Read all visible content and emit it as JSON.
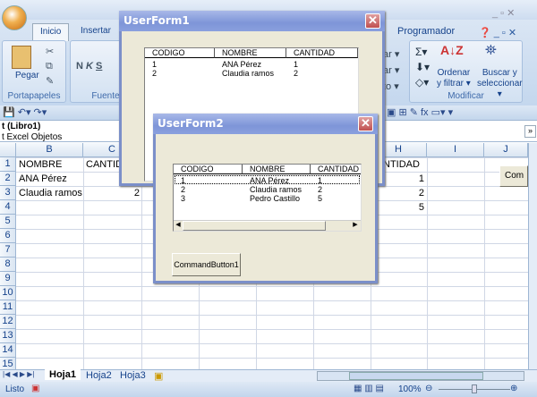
{
  "ribbon": {
    "tabs": [
      "Inicio",
      "Insertar",
      "Programador"
    ],
    "clipboard": {
      "paste": "Pegar",
      "group": "Portapapeles"
    },
    "font_group": "Fuente",
    "edit": {
      "sort": "Ordenar",
      "sort2": "y filtrar ▾",
      "find": "Buscar y",
      "find2": "seleccionar ▾",
      "group": "Modificar"
    },
    "partial": [
      "ar ▾",
      "ar ▾",
      "to ▾"
    ]
  },
  "formula_bar": {
    "line1": "t (Libro1)",
    "line2": "t Excel Objetos"
  },
  "columns": [
    "B",
    "C",
    "H",
    "I",
    "J"
  ],
  "rows": [
    "1",
    "2",
    "3",
    "4",
    "5",
    "6",
    "7",
    "8",
    "9",
    "10",
    "11",
    "12",
    "13",
    "14",
    "15"
  ],
  "cells": {
    "b1": "NOMBRE",
    "c1": "CANTID",
    "b2": "ANA Pérez",
    "b3": "Claudia ramos",
    "c3": "2",
    "h1": "NTIDAD",
    "h2": "1",
    "h3": "2",
    "h4": "5",
    "j2_button": "Com"
  },
  "sheet_tabs": [
    "Hoja1",
    "Hoja2",
    "Hoja3"
  ],
  "status": {
    "ready": "Listo",
    "zoom": "100%"
  },
  "userform1": {
    "title": "UserForm1",
    "headers": [
      "CODIGO",
      "NOMBRE",
      "CANTIDAD"
    ],
    "rows": [
      [
        "1",
        "ANA Pérez",
        "1"
      ],
      [
        "2",
        "Claudia ramos",
        "2"
      ]
    ]
  },
  "userform2": {
    "title": "UserForm2",
    "headers": [
      "CODIGO",
      "NOMBRE",
      "CANTIDAD"
    ],
    "rows": [
      [
        "1",
        "ANA Pérez",
        "1"
      ],
      [
        "2",
        "Claudia ramos",
        "2"
      ],
      [
        "3",
        "Pedro Castillo",
        "5"
      ]
    ],
    "button": "CommandButton1"
  }
}
